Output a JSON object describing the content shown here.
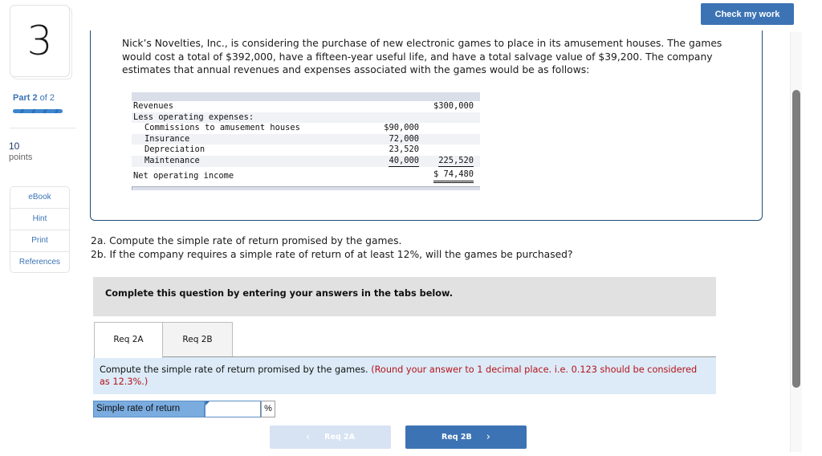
{
  "question": {
    "number": "3",
    "part_prefix": "Part",
    "part_current": "2",
    "part_suffix": "of 2",
    "progress_fraction": 1.0,
    "points_value": "10",
    "points_label": "points"
  },
  "tools": [
    "eBook",
    "Hint",
    "Print",
    "References"
  ],
  "check_button": "Check my work",
  "problem": {
    "intro": "Nick’s Novelties, Inc., is considering the purchase of new electronic games to place in its amusement houses. The games would cost a total of $392,000, have a fifteen-year useful life, and have a total salvage value of $39,200. The company estimates that annual revenues and expenses associated with the games would be as follows:",
    "statement": {
      "revenues_label": "Revenues",
      "revenues_value": "$300,000",
      "less_label": "Less operating expenses:",
      "expenses": [
        {
          "label": "Commissions to amusement houses",
          "value": "$90,000"
        },
        {
          "label": "Insurance",
          "value": "72,000"
        },
        {
          "label": "Depreciation",
          "value": "23,520"
        },
        {
          "label": "Maintenance",
          "value": "40,000"
        }
      ],
      "total_expenses": "225,520",
      "net_label": "Net operating income",
      "net_value": "$ 74,480"
    },
    "req_2a": "2a. Compute the simple rate of return promised by the games.",
    "req_2b": "2b. If the company requires a simple rate of return of at least 12%, will the games be purchased?"
  },
  "banner": "Complete this question by entering your answers in the tabs below.",
  "tabs": [
    {
      "label": "Req 2A",
      "active": true
    },
    {
      "label": "Req 2B",
      "active": false
    }
  ],
  "instruction": {
    "text": "Compute the simple rate of return promised by the games.",
    "note": "(Round your answer to 1 decimal place. i.e. 0.123 should be considered as 12.3%.)"
  },
  "answer": {
    "label": "Simple rate of return",
    "value": "",
    "unit": "%"
  },
  "nav": {
    "prev_label": "Req 2A",
    "next_label": "Req 2B",
    "prev_icon": "‹",
    "next_icon": "›"
  },
  "colors": {
    "accent": "#3c73b4",
    "note_red": "#b5121b",
    "instruction_bg": "#dcebf7",
    "label_bg": "#7aace0"
  }
}
